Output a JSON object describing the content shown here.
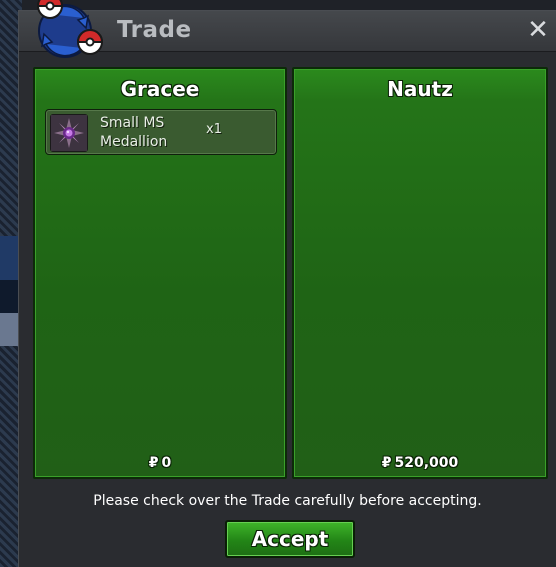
{
  "window": {
    "title": "Trade",
    "close_glyph": "✕"
  },
  "left_panel": {
    "player_name": "Gracee",
    "items": [
      {
        "name": "Small MS Medallion",
        "quantity": "x1",
        "icon": "medallion-icon"
      }
    ],
    "money_symbol": "₽",
    "money": "0"
  },
  "right_panel": {
    "player_name": "Nautz",
    "items": [],
    "money_symbol": "₽",
    "money": "520,000"
  },
  "notice": "Please check over the Trade carefully before accepting.",
  "accept_label": "Accept",
  "colors": {
    "panel_green": "#247418",
    "accept_green": "#2e9c1f",
    "titlebar": "#3e4145"
  }
}
